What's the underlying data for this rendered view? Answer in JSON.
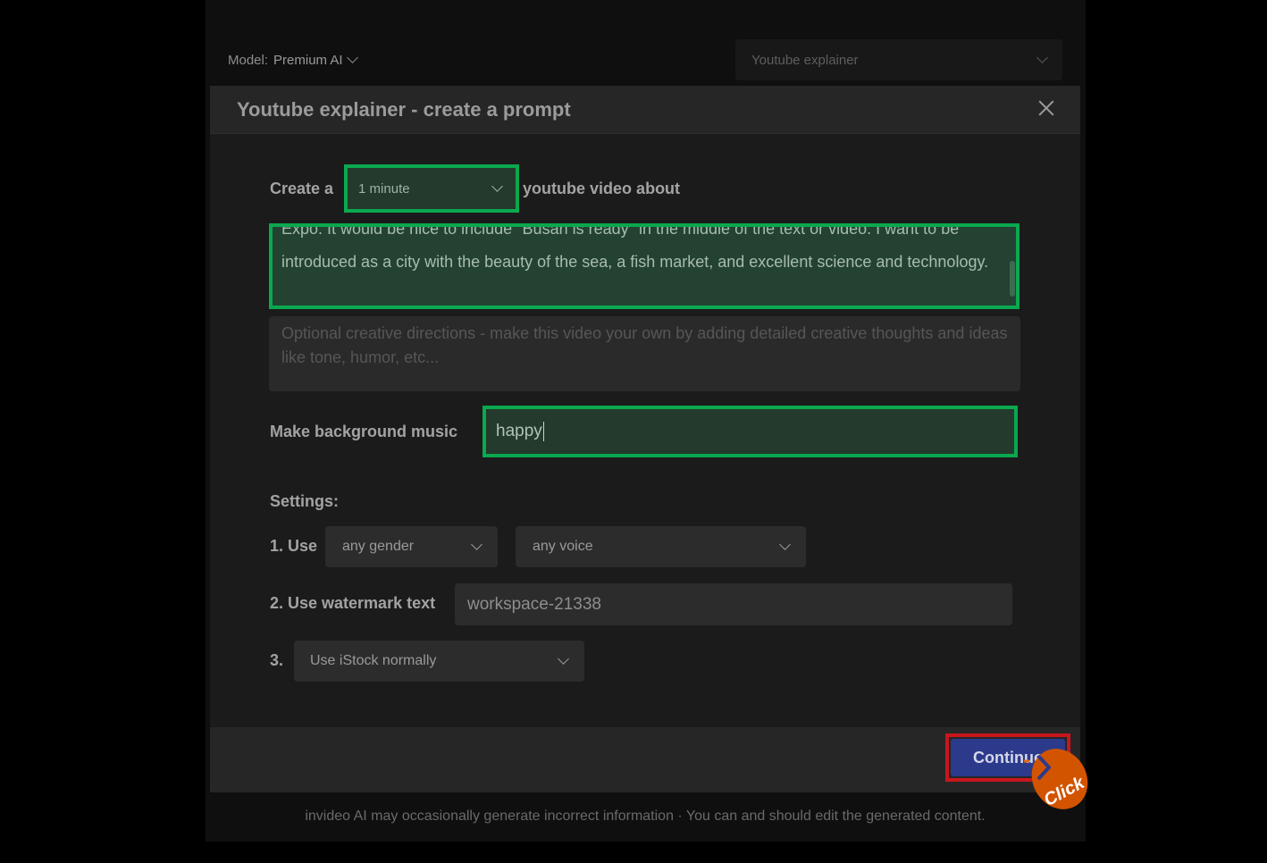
{
  "top_bar": {
    "model_label": "Model:",
    "model_value": "Premium AI",
    "template_value": "Youtube explainer"
  },
  "modal": {
    "title": "Youtube explainer - create a prompt",
    "create_prefix": "Create a",
    "duration_value": "1 minute",
    "create_suffix": "youtube video about",
    "topic_text": "Expo. It would be nice to include \"Busan is ready\" in the middle of the text or video. I want to be introduced as a city with the beauty of the sea, a fish market, and excellent science and technology.",
    "directions_placeholder": "Optional creative directions - make this video your own by adding detailed creative thoughts and ideas like tone, humor, etc...",
    "music_label": "Make background music",
    "music_value": "happy",
    "settings_label": "Settings:",
    "setting1_label": "1. Use",
    "gender_value": "any gender",
    "voice_value": "any voice",
    "setting2_label": "2. Use watermark text",
    "watermark_value": "workspace-21338",
    "setting3_label": "3.",
    "istock_value": "Use iStock normally",
    "continue_label": "Continue",
    "click_hint": "Click"
  },
  "footer_note": "invideo AI may occasionally generate incorrect information · You can and should edit the generated content.",
  "colors": {
    "highlight": "#0aa84f",
    "click_target": "#c8161d",
    "primary_button": "#2c3a8c",
    "click_badge": "#d35400"
  }
}
